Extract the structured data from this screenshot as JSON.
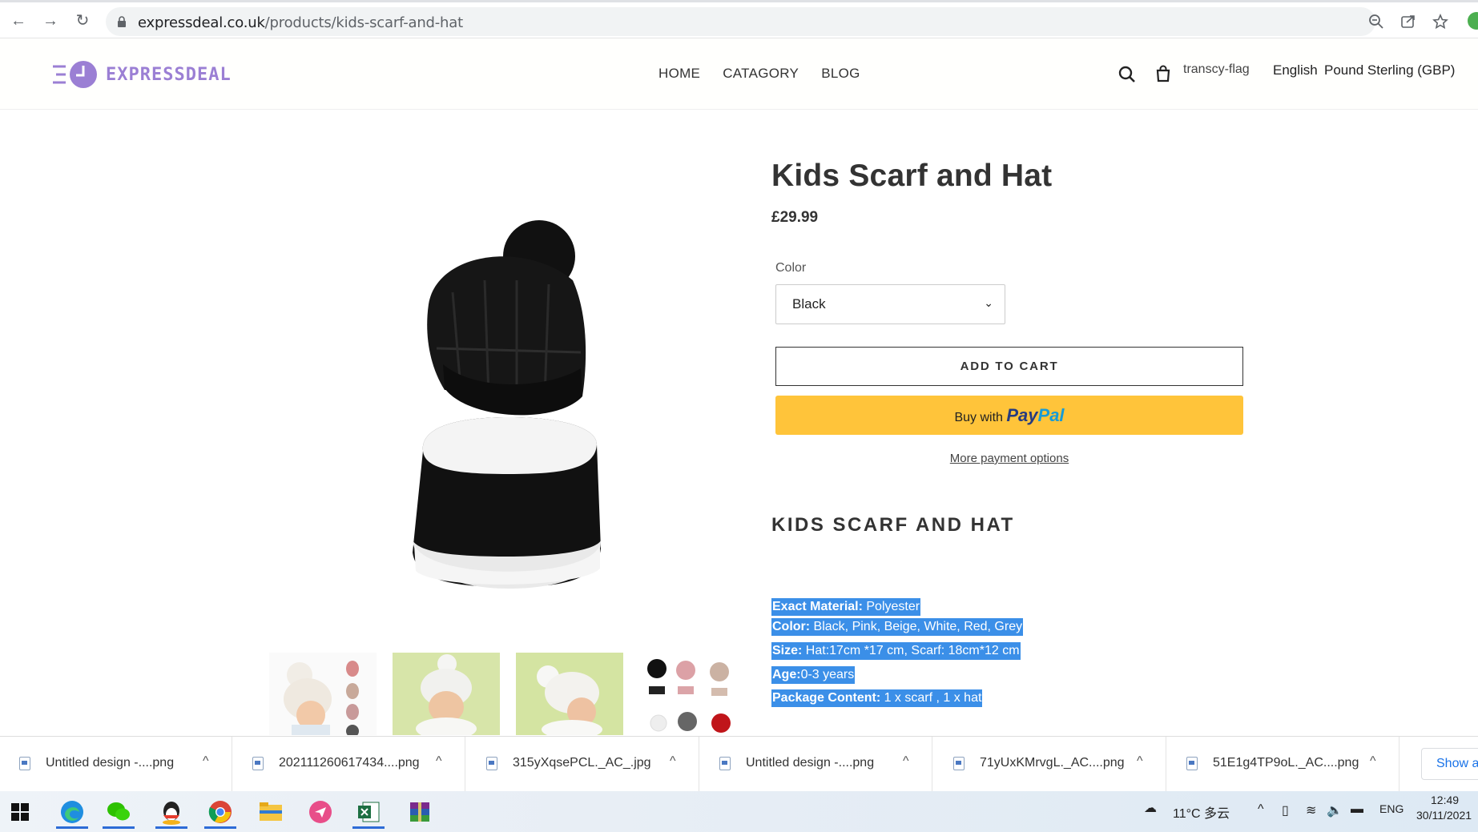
{
  "browser": {
    "url_host": "expressdeal.co.uk",
    "url_path": "/products/kids-scarf-and-hat"
  },
  "store": {
    "logo_text": "EXPRESSDEAL",
    "nav": [
      "HOME",
      "CATAGORY",
      "BLOG"
    ],
    "flag_alt": "transcy-flag",
    "language": "English",
    "currency": "Pound Sterling (GBP)"
  },
  "product": {
    "title": "Kids Scarf and Hat",
    "price": "£29.99",
    "color_label": "Color",
    "color_selected": "Black",
    "add_to_cart": "ADD TO CART",
    "paypal_prefix": "Buy with",
    "paypal_brand_1": "Pay",
    "paypal_brand_2": "Pal",
    "more_payment": "More payment options",
    "desc_title": "KIDS SCARF AND HAT",
    "specs": [
      {
        "label": "Exact Material:",
        "value": " Polyester"
      },
      {
        "label": "Color:",
        "value": " Black, Pink, Beige, White, Red, Grey"
      },
      {
        "label": "Size:",
        "value": " Hat:17cm *17 cm, Scarf: 18cm*12 cm"
      },
      {
        "label": "Age:",
        "value": "0-3 years"
      },
      {
        "label": "Package Content:",
        "value": " 1 x scarf , 1 x hat"
      }
    ]
  },
  "downloads": [
    "Untitled design -....png",
    "202111260617434....png",
    "315yXqsePCL._AC_.jpg",
    "Untitled design -....png",
    "71yUxKMrvgL._AC....png",
    "51E1g4TP9oL._AC....png"
  ],
  "downloads_show_all": "Show all",
  "taskbar": {
    "weather": "11°C 多云",
    "lang": "ENG",
    "time": "12:49",
    "date": "30/11/2021"
  },
  "colors": {
    "accent": "#9b7fd4",
    "paypal_yellow": "#ffc43a",
    "selection_blue": "#3b8fe8"
  }
}
